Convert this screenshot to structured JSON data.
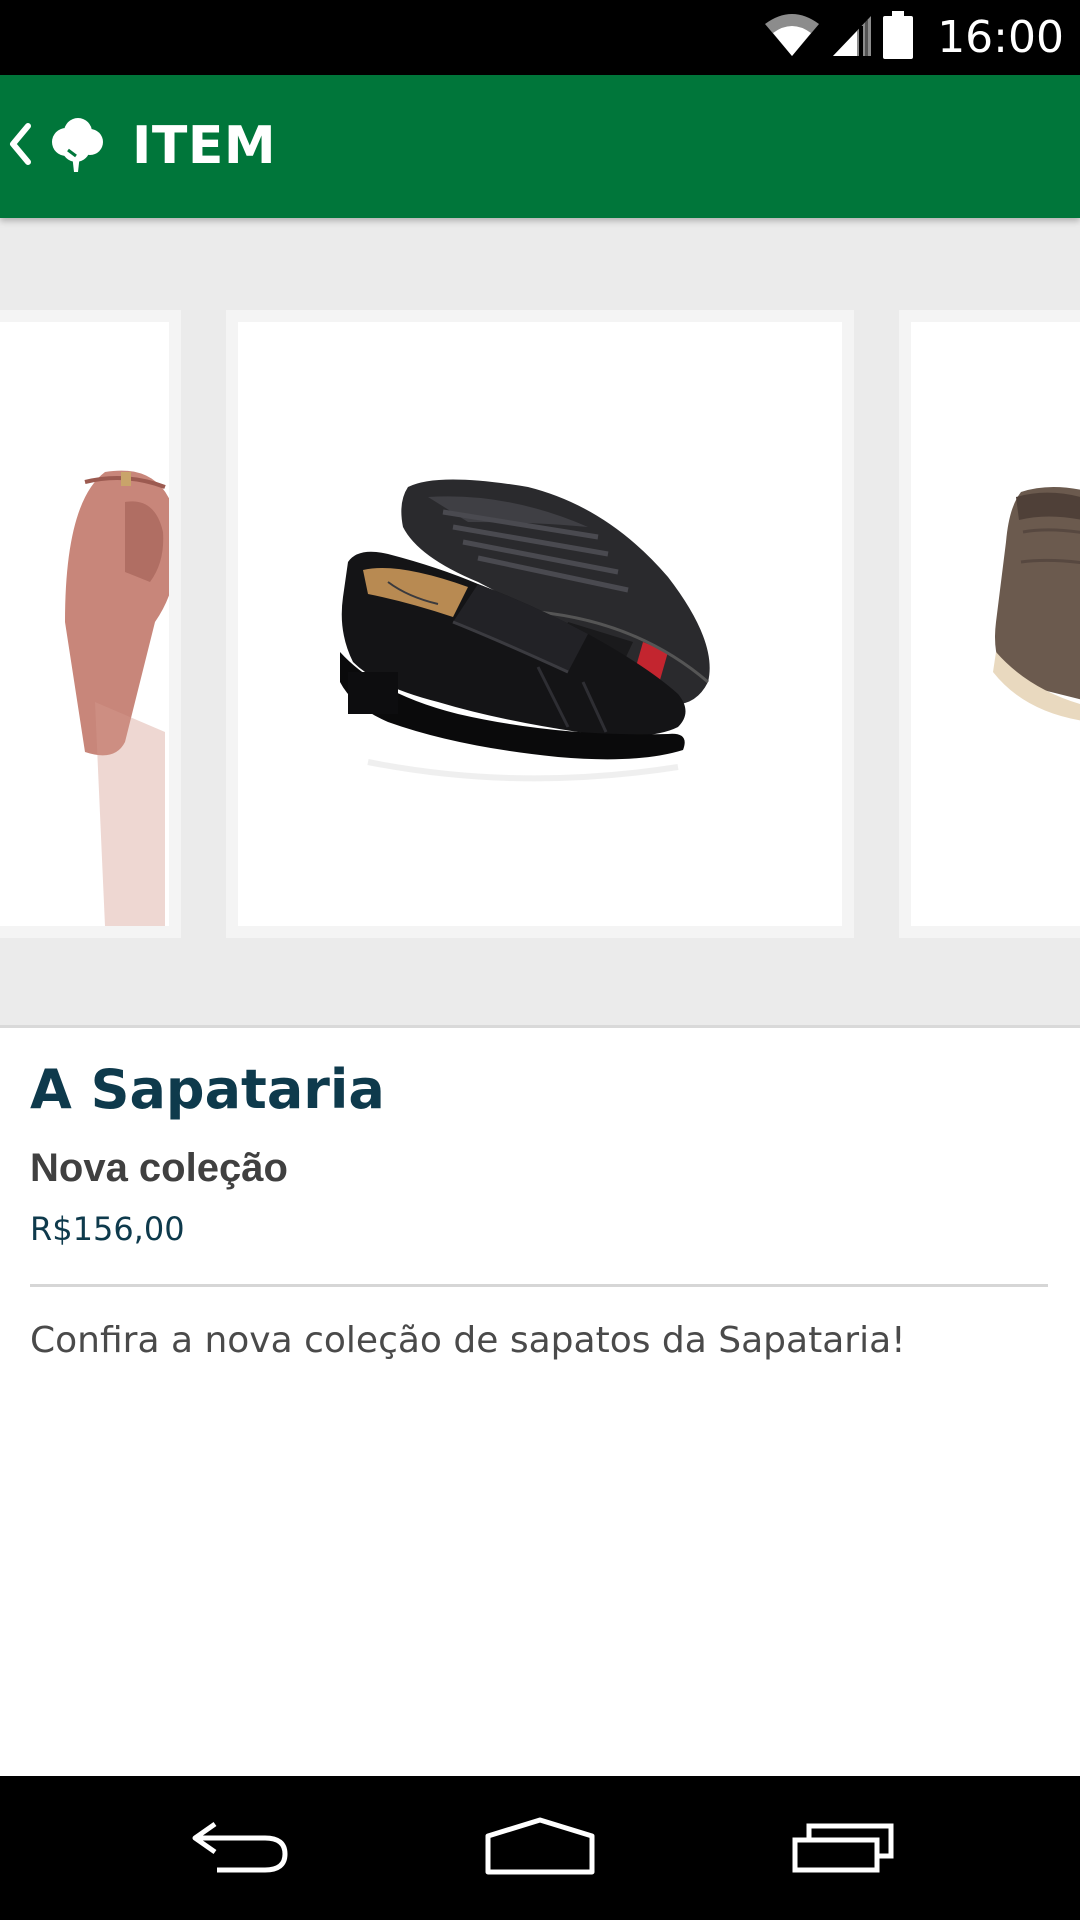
{
  "status_bar": {
    "time": "16:00",
    "icons": [
      "wifi-icon",
      "signal-icon",
      "battery-icon"
    ]
  },
  "app_bar": {
    "title": "ITEM",
    "back_icon": "chevron-left-icon",
    "logo_icon": "tree-logo-icon",
    "background_color": "#00763a"
  },
  "carousel": {
    "images": [
      {
        "name": "pink-heeled-shoe-image"
      },
      {
        "name": "black-leather-loafers-image"
      },
      {
        "name": "brown-boot-image"
      }
    ]
  },
  "item": {
    "store": "A Sapataria",
    "name": "Nova coleção",
    "price": "R$156,00",
    "description": "Confira a nova coleção de sapatos da Sapataria!"
  },
  "colors": {
    "accent": "#00763a",
    "store_name": "#0e3a4c",
    "text": "#404040"
  },
  "nav_bar": {
    "buttons": [
      "back-nav-icon",
      "home-nav-icon",
      "recents-nav-icon"
    ]
  }
}
